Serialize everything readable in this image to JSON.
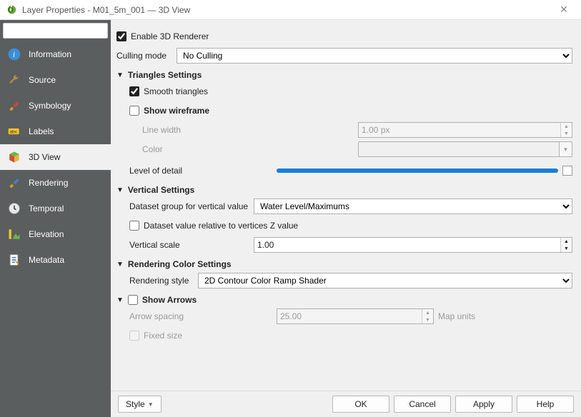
{
  "window": {
    "title": "Layer Properties - M01_5m_001 — 3D View"
  },
  "sidebar": {
    "items": [
      {
        "label": "Information"
      },
      {
        "label": "Source"
      },
      {
        "label": "Symbology"
      },
      {
        "label": "Labels"
      },
      {
        "label": "3D View"
      },
      {
        "label": "Rendering"
      },
      {
        "label": "Temporal"
      },
      {
        "label": "Elevation"
      },
      {
        "label": "Metadata"
      }
    ]
  },
  "content": {
    "enable_3d": "Enable 3D Renderer",
    "culling_label": "Culling mode",
    "culling_value": "No Culling",
    "triangles": {
      "header": "Triangles Settings",
      "smooth": "Smooth triangles",
      "show_wireframe": "Show wireframe",
      "line_width_label": "Line width",
      "line_width_value": "1.00 px",
      "color_label": "Color",
      "lod_label": "Level of detail"
    },
    "vertical": {
      "header": "Vertical Settings",
      "dataset_label": "Dataset group for vertical value",
      "dataset_value": "Water Level/Maximums",
      "relative_label": "Dataset value relative to vertices Z value",
      "scale_label": "Vertical scale",
      "scale_value": "1.00"
    },
    "rendercolor": {
      "header": "Rendering Color Settings",
      "style_label": "Rendering style",
      "style_value": "2D Contour Color Ramp Shader"
    },
    "arrows": {
      "header": "Show Arrows",
      "spacing_label": "Arrow spacing",
      "spacing_value": "25.00",
      "spacing_unit": "Map units",
      "fixed_label": "Fixed size"
    }
  },
  "footer": {
    "style": "Style",
    "ok": "OK",
    "cancel": "Cancel",
    "apply": "Apply",
    "help": "Help"
  }
}
